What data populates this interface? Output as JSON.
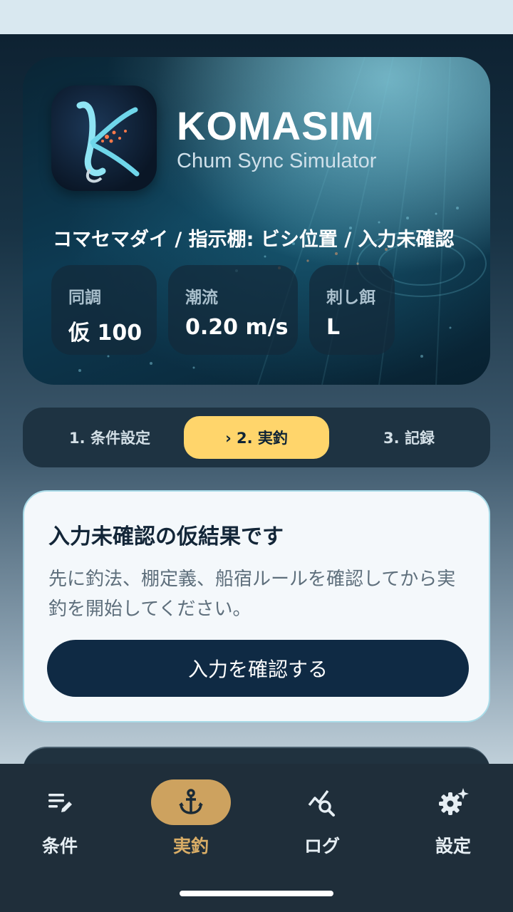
{
  "app": {
    "title": "KOMASIM",
    "subtitle": "Chum Sync Simulator"
  },
  "hero": {
    "condition": "コマセマダイ / 指示棚: ビシ位置 / 入力未確認",
    "stats": [
      {
        "label": "同調",
        "value": "仮 100"
      },
      {
        "label": "潮流",
        "value": "0.20 m/s"
      },
      {
        "label": "刺し餌",
        "value": "L"
      }
    ]
  },
  "steps": [
    {
      "label": "1. 条件設定",
      "active": false
    },
    {
      "label": "› 2. 実釣",
      "active": true
    },
    {
      "label": "3. 記録",
      "active": false
    }
  ],
  "notice": {
    "title": "入力未確認の仮結果です",
    "description": "先に釣法、棚定義、船宿ルールを確認してから実釣を開始してください。",
    "button_label": "入力を確認する"
  },
  "bottom_nav": [
    {
      "label": "条件",
      "icon": "edit-list-icon",
      "active": false
    },
    {
      "label": "実釣",
      "icon": "anchor-icon",
      "active": true
    },
    {
      "label": "ログ",
      "icon": "chart-search-icon",
      "active": false
    },
    {
      "label": "設定",
      "icon": "gear-sparkle-icon",
      "active": false
    }
  ],
  "colors": {
    "accent_yellow": "#ffd56b",
    "nav_active": "#cda25f",
    "primary_dark": "#0f2a44"
  }
}
